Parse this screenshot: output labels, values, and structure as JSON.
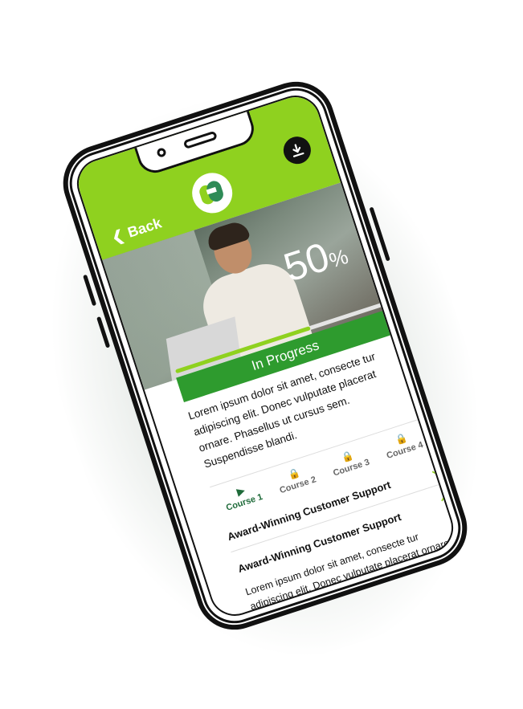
{
  "header": {
    "back_label": "Back",
    "back_icon": "chevron-left-icon",
    "logo_icon": "brand-logo-icon",
    "download_icon": "download-icon",
    "accent_color": "#8fd11f",
    "dark_accent": "#2e9b2e"
  },
  "progress": {
    "percent_value": "50",
    "percent_symbol": "%",
    "fraction": 0.65,
    "status_label": "In Progress"
  },
  "description": "Lorem ipsum dolor sit amet, consecte tur adipiscing elit. Donec vulputate placerat ornare. Phasellus ut cursus sem. Suspendisse blandi.",
  "tabs": [
    {
      "label": "Course 1",
      "icon": "play-icon",
      "active": true
    },
    {
      "label": "Course 2",
      "icon": "lock-icon",
      "active": false
    },
    {
      "label": "Course 3",
      "icon": "lock-icon",
      "active": false
    },
    {
      "label": "Course 4",
      "icon": "lock-icon",
      "active": false
    }
  ],
  "sections": [
    {
      "title": "Award-Winning Customer Support",
      "state": "collapsed",
      "chevron": "chevron-down-icon"
    },
    {
      "title": "Award-Winning Customer Support",
      "state": "expanded",
      "chevron": "chevron-up-icon",
      "body": "Lorem ipsum dolor sit amet, consecte tur adipiscing elit. Donec vulputate placerat ornare. Phasellus ut cursus sem."
    }
  ]
}
